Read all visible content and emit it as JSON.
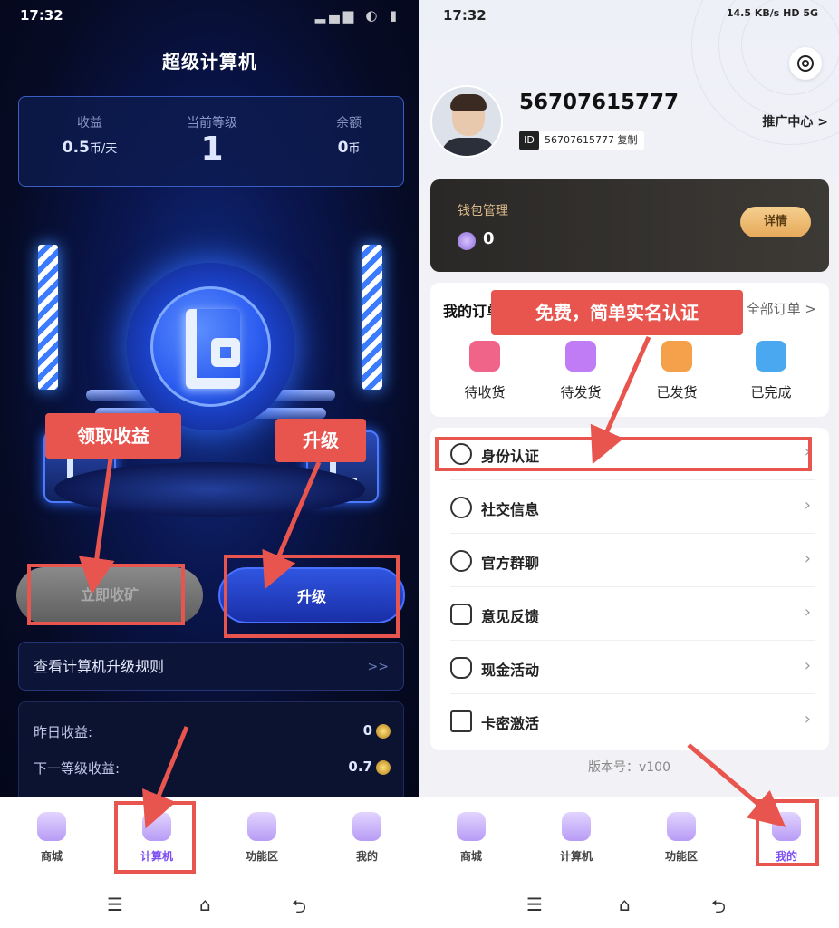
{
  "left": {
    "status_time": "17:32",
    "title": "超级计算机",
    "stats": [
      {
        "label": "收益",
        "value": "0.5",
        "unit": "币/天"
      },
      {
        "label": "当前等级",
        "value": "1",
        "unit": ""
      },
      {
        "label": "余额",
        "value": "0",
        "unit": "币"
      }
    ],
    "collect_button": "立即收矿",
    "upgrade_button": "升级",
    "rules_link": "查看计算机升级规则",
    "rules_arrow": ">>",
    "earnings": [
      {
        "label": "昨日收益:",
        "value": "0"
      },
      {
        "label": "下一等级收益:",
        "value": "0.7"
      }
    ],
    "annotations": {
      "collect": "领取收益",
      "upgrade": "升级"
    }
  },
  "right": {
    "status_time": "17:32",
    "status_right": "14.5 KB/s  HD  5G",
    "username": "56707615777",
    "id_tag": "ID",
    "id_value": "56707615777 复制",
    "promo_center": "推广中心 >",
    "wallet": {
      "title": "钱包管理",
      "amount": "0",
      "detail_button": "详情"
    },
    "orders": {
      "title": "我的订单",
      "all_link": "全部订单 >",
      "items": [
        {
          "label": "待收货",
          "color": "#f0648a"
        },
        {
          "label": "待发货",
          "color": "#c07cf5"
        },
        {
          "label": "已发货",
          "color": "#f5a04a"
        },
        {
          "label": "已完成",
          "color": "#4aa8f0"
        }
      ]
    },
    "menu": [
      {
        "label": "身份认证",
        "icon": "user-add-icon"
      },
      {
        "label": "社交信息",
        "icon": "chat-icon"
      },
      {
        "label": "官方群聊",
        "icon": "group-chat-icon"
      },
      {
        "label": "意见反馈",
        "icon": "feedback-icon"
      },
      {
        "label": "现金活动",
        "icon": "money-bag-icon"
      },
      {
        "label": "卡密激活",
        "icon": "card-icon"
      }
    ],
    "version": "版本号：v100",
    "annotation": "免费，简单实名认证"
  },
  "nav": {
    "items": [
      {
        "label": "商城",
        "icon": "shop-icon"
      },
      {
        "label": "计算机",
        "icon": "computer-icon"
      },
      {
        "label": "功能区",
        "icon": "apps-icon"
      },
      {
        "label": "我的",
        "icon": "profile-icon"
      }
    ],
    "left_active": "计算机",
    "right_active": "我的"
  },
  "colors": {
    "annotation_red": "#e8554e",
    "accent_purple": "#7b4ef0",
    "upgrade_blue": "#2f55e0"
  }
}
